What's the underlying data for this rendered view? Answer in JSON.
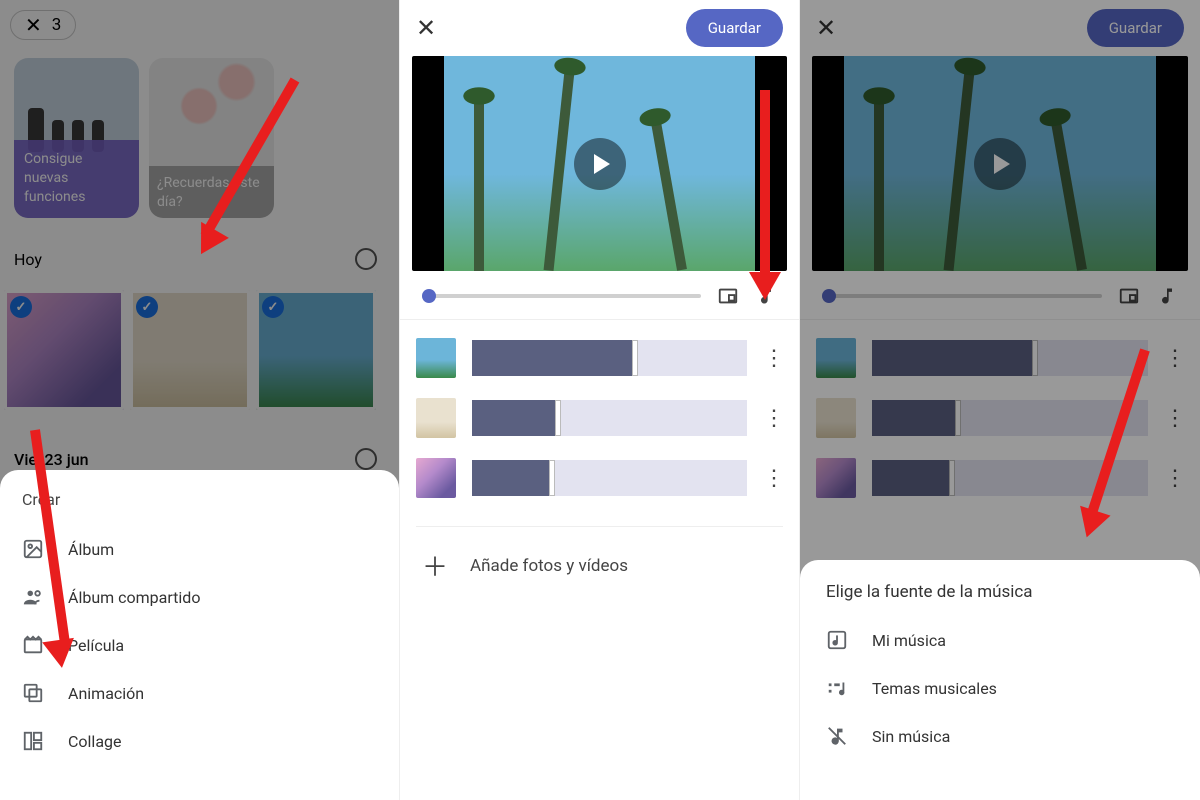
{
  "panel1": {
    "selection_count": "3",
    "card1": "Consigue nuevas funciones",
    "card2": "¿Recuerdas este día?",
    "section_today": "Hoy",
    "section_date": "Vie, 23 jun",
    "sheet_title": "Crear",
    "options": {
      "album": "Álbum",
      "shared_album": "Álbum compartido",
      "movie": "Película",
      "animation": "Animación",
      "collage": "Collage"
    }
  },
  "panel2": {
    "save": "Guardar",
    "clips": [
      {
        "fill": 58
      },
      {
        "fill": 30
      },
      {
        "fill": 28
      }
    ],
    "add_line": "Añade fotos y vídeos"
  },
  "panel3": {
    "save": "Guardar",
    "clips": [
      {
        "fill": 58
      },
      {
        "fill": 30
      },
      {
        "fill": 28
      }
    ],
    "sheet_title": "Elige la fuente de la música",
    "options": {
      "my_music": "Mi música",
      "themes": "Temas musicales",
      "no_music": "Sin música"
    }
  }
}
